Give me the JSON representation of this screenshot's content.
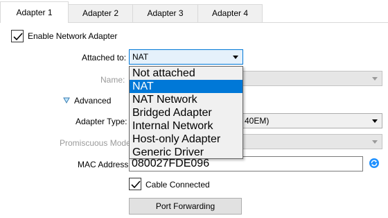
{
  "tabs": [
    {
      "label": "Adapter 1",
      "active": true
    },
    {
      "label": "Adapter 2",
      "active": false
    },
    {
      "label": "Adapter 3",
      "active": false
    },
    {
      "label": "Adapter 4",
      "active": false
    }
  ],
  "enable_adapter": {
    "label": "Enable Network Adapter",
    "checked": true
  },
  "attached_to": {
    "label": "Attached to:",
    "value": "NAT"
  },
  "name": {
    "label": "Name:"
  },
  "advanced": {
    "label": "Advanced"
  },
  "adapter_type": {
    "label": "Adapter Type:",
    "value_tail": "40EM)"
  },
  "promiscuous": {
    "label": "Promiscuous Mode:"
  },
  "mac_address": {
    "label": "MAC Address:",
    "value": "080027FDE096"
  },
  "cable_connected": {
    "label": "Cable Connected",
    "checked": true
  },
  "port_forwarding": {
    "label": "Port Forwarding"
  },
  "dropdown_options": [
    {
      "label": "Not attached",
      "selected": false
    },
    {
      "label": "NAT",
      "selected": true
    },
    {
      "label": "NAT Network",
      "selected": false
    },
    {
      "label": "Bridged Adapter",
      "selected": false
    },
    {
      "label": "Internal Network",
      "selected": false
    },
    {
      "label": "Host-only Adapter",
      "selected": false
    },
    {
      "label": "Generic Driver",
      "selected": false
    }
  ],
  "colors": {
    "accent": "#0078d7",
    "refresh_icon": "#1e90ff"
  },
  "icons": {
    "refresh": "refresh-icon",
    "expand": "triangle-down-icon",
    "check": "checkmark-icon"
  }
}
